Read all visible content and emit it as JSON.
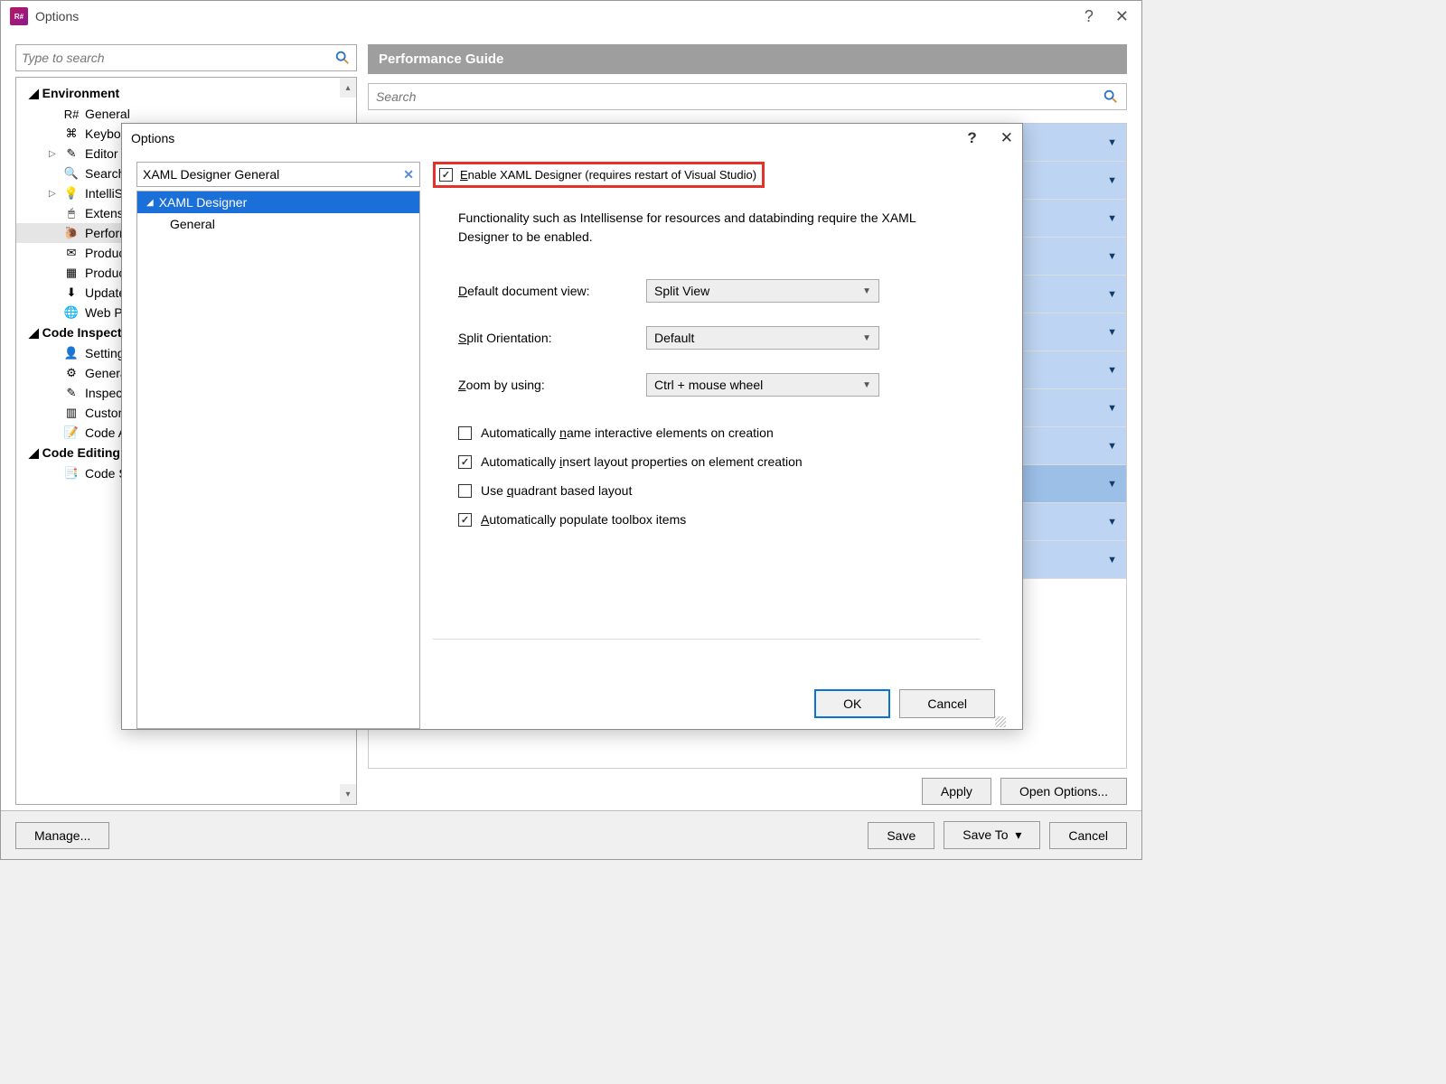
{
  "outer": {
    "title": "Options",
    "search_placeholder": "Type to search",
    "sidebar": {
      "groups": [
        {
          "label": "Environment",
          "items": [
            {
              "label": "General",
              "icon": "rsharp"
            },
            {
              "label": "Keyboard",
              "icon": "keys"
            },
            {
              "label": "Editor",
              "icon": "pencil",
              "expandable": true
            },
            {
              "label": "Search & Navigation",
              "icon": "mag"
            },
            {
              "label": "IntelliSense",
              "icon": "bulb",
              "expandable": true
            },
            {
              "label": "Extension Manager",
              "icon": "ext"
            },
            {
              "label": "Performance Guide",
              "icon": "perf",
              "selected": true
            },
            {
              "label": "Products & Features",
              "icon": "mail"
            },
            {
              "label": "Product Feedback",
              "icon": "grid"
            },
            {
              "label": "Updates",
              "icon": "download"
            },
            {
              "label": "Web Proxy Settings",
              "icon": "proxy"
            }
          ]
        },
        {
          "label": "Code Inspection",
          "items": [
            {
              "label": "Settings",
              "icon": "user"
            },
            {
              "label": "Generated Code",
              "icon": "gear"
            },
            {
              "label": "Inspection Severity",
              "icon": "inspect"
            },
            {
              "label": "Custom Patterns",
              "icon": "pattern"
            },
            {
              "label": "Code Annotations",
              "icon": "annot"
            }
          ]
        },
        {
          "label": "Code Editing",
          "items": [
            {
              "label": "Code Style Sharing",
              "icon": "share"
            }
          ]
        }
      ]
    },
    "main": {
      "header": "Performance Guide",
      "search_placeholder": "Search",
      "rows": 12,
      "apply": "Apply",
      "open_options": "Open Options..."
    },
    "bottom": {
      "manage": "Manage...",
      "save": "Save",
      "save_to": "Save To",
      "cancel": "Cancel"
    }
  },
  "inner": {
    "title": "Options",
    "search_value": "XAML Designer General",
    "tree": {
      "parent": "XAML Designer",
      "child": "General"
    },
    "enable_label": "Enable XAML Designer (requires restart of Visual Studio)",
    "enable_checked": true,
    "info1": "Functionality such as Intellisense for resources and databinding require the XAML Designer to be enabled.",
    "form": {
      "default_view_label": "Default document view:",
      "default_view_value": "Split View",
      "split_label": "Split Orientation:",
      "split_value": "Default",
      "zoom_label": "Zoom by using:",
      "zoom_value": "Ctrl + mouse wheel"
    },
    "checks": [
      {
        "label": "Automatically name interactive elements on creation",
        "checked": false
      },
      {
        "label": "Automatically insert layout properties on element creation",
        "checked": true
      },
      {
        "label": "Use quadrant based layout",
        "checked": false
      },
      {
        "label": "Automatically populate toolbox items",
        "checked": true
      }
    ],
    "ok": "OK",
    "cancel": "Cancel"
  }
}
